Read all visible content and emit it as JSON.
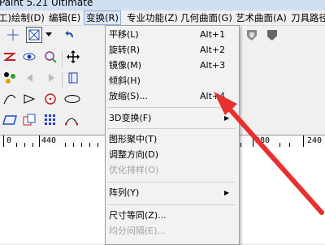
{
  "window": {
    "title": "Paint 5.21 Ultimate"
  },
  "menubar": {
    "items": [
      "工)",
      "绘制(D)",
      "编辑(E)",
      "变换(R)",
      "专业功能(Z)",
      "几何曲面(G)",
      "艺术曲面(A)",
      "刀具路径"
    ]
  },
  "dropdown": {
    "items": [
      {
        "label": "平移(L)",
        "accel": "Alt+1",
        "enabled": true
      },
      {
        "label": "旋转(R)",
        "accel": "Alt+2",
        "enabled": true
      },
      {
        "label": "镜像(M)",
        "accel": "Alt+3",
        "enabled": true
      },
      {
        "label": "倾斜(H)",
        "accel": "",
        "enabled": true
      },
      {
        "label": "放缩(S)...",
        "accel": "Alt+4",
        "enabled": true
      },
      {
        "label": "3D变换(F)",
        "accel": "",
        "enabled": true,
        "submenu": true
      },
      {
        "label": "图形聚中(T)",
        "accel": "",
        "enabled": true
      },
      {
        "label": "调整方向(D)",
        "accel": "",
        "enabled": true
      },
      {
        "label": "优化排样(O)",
        "accel": "",
        "enabled": false
      },
      {
        "label": "阵列(Y)",
        "accel": "",
        "enabled": true,
        "submenu": true
      },
      {
        "label": "尺寸等同(Z)...",
        "accel": "",
        "enabled": true
      },
      {
        "label": "均分间隔(E)...",
        "accel": "",
        "enabled": false
      }
    ]
  },
  "ruler": {
    "labels": [
      "0",
      "440",
      "280",
      "240"
    ]
  },
  "toolbar_icons": [
    "crosshair-icon",
    "select-box-icon",
    "dropdown-arrow-icon",
    "undo-icon",
    "zigzag-icon",
    "eye-icon",
    "zoom-icon",
    "move-icon",
    "node-icon",
    "arrow-left-icon",
    "arrow-right-icon",
    "book-icon",
    "curve-icon",
    "triangle-icon",
    "circle-icon",
    "ellipse-icon",
    "parallelogram-icon",
    "copy-icon",
    "grid-icon",
    "arc-icon",
    "shield-icon",
    "shield-dark-icon"
  ],
  "colors": {
    "annotation_arrow": "#e83030",
    "accent": "#2b6cc8"
  }
}
